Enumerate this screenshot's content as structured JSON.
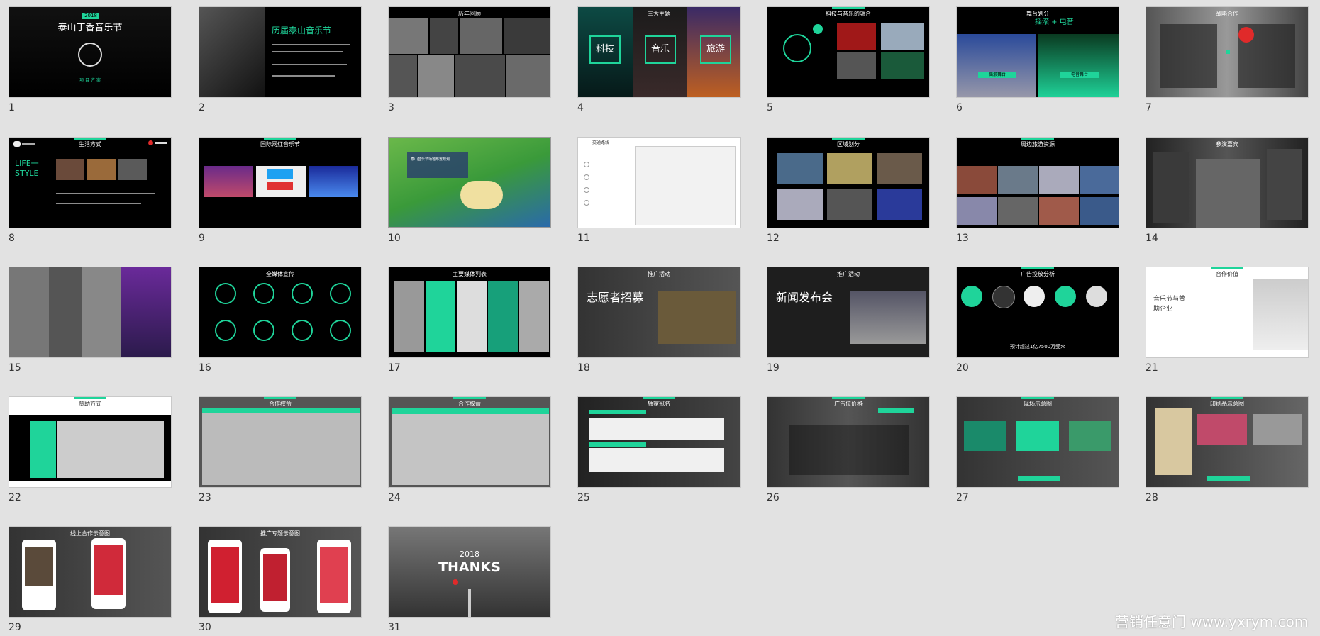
{
  "watermark": "营销任意门 www.yxrym.com",
  "slides": [
    {
      "num": "1",
      "title": "泰山丁香音乐节",
      "year": "2018",
      "sub": "项 目 方 案"
    },
    {
      "num": "2",
      "title": "历届泰山音乐节"
    },
    {
      "num": "3",
      "title": "历年回顾"
    },
    {
      "num": "4",
      "title": "三大主题",
      "labels": [
        "科技",
        "音乐",
        "旅游"
      ]
    },
    {
      "num": "5",
      "title": "科技与音乐的融合"
    },
    {
      "num": "6",
      "title": "舞台划分",
      "headline": "摇滚 + 电音",
      "stage_a": "摇滚舞台",
      "stage_b": "电音舞台"
    },
    {
      "num": "7",
      "title": "战略合作"
    },
    {
      "num": "8",
      "title": "生活方式",
      "headline": "LIFE一STYLE"
    },
    {
      "num": "9",
      "title": "国际网红音乐节"
    },
    {
      "num": "10",
      "title": "泰山音乐节场地布置规划"
    },
    {
      "num": "11",
      "title": "交通路线"
    },
    {
      "num": "12",
      "title": "区域划分"
    },
    {
      "num": "13",
      "title": "周边旅游资源"
    },
    {
      "num": "14",
      "title": "参演嘉宾"
    },
    {
      "num": "15",
      "title": ""
    },
    {
      "num": "16",
      "title": "全媒体宣传"
    },
    {
      "num": "17",
      "title": "主要媒体列表"
    },
    {
      "num": "18",
      "title": "推广活动",
      "headline": "志愿者招募"
    },
    {
      "num": "19",
      "title": "推广活动",
      "headline": "新闻发布会"
    },
    {
      "num": "20",
      "title": "广告投放分析",
      "footer": "预计超过1亿7500万受众"
    },
    {
      "num": "21",
      "title": "合作价值",
      "headline": "音乐节与赞助企业"
    },
    {
      "num": "22",
      "title": "赞助方式"
    },
    {
      "num": "23",
      "title": "合作权益"
    },
    {
      "num": "24",
      "title": "合作权益"
    },
    {
      "num": "25",
      "title": "独家冠名"
    },
    {
      "num": "26",
      "title": "广告位价格"
    },
    {
      "num": "27",
      "title": "现场示意图"
    },
    {
      "num": "28",
      "title": "印刷品示意图"
    },
    {
      "num": "29",
      "title": "线上合作示意图"
    },
    {
      "num": "30",
      "title": "推广专题示意图"
    },
    {
      "num": "31",
      "title": "THANKS",
      "year": "2018"
    }
  ]
}
